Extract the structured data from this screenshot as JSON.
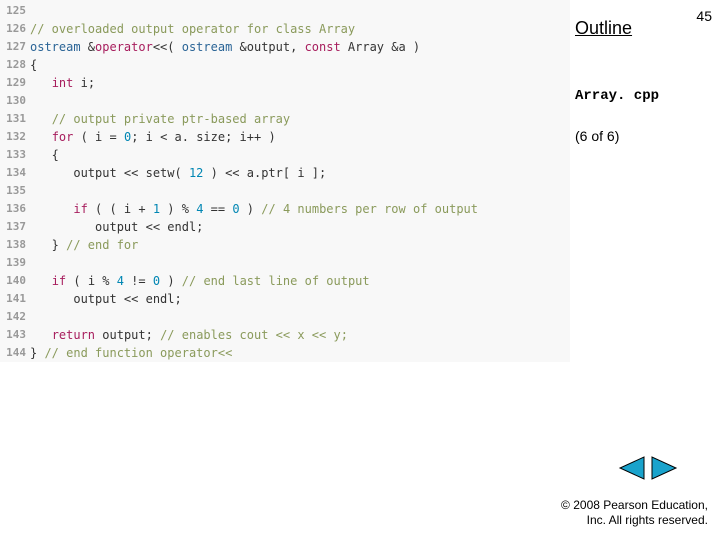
{
  "slide": {
    "outline_label": "Outline",
    "page_number": "45",
    "filename": "Array. cpp",
    "pager": "(6 of 6)",
    "copyright_line1": "© 2008 Pearson Education,",
    "copyright_line2": "Inc.  All rights reserved."
  },
  "code": {
    "lines": [
      {
        "n": "125",
        "tokens": []
      },
      {
        "n": "126",
        "tokens": [
          {
            "c": "c-comment",
            "t": "// overloaded output operator for class Array"
          }
        ]
      },
      {
        "n": "127",
        "tokens": [
          {
            "c": "c-type",
            "t": "ostream "
          },
          {
            "c": "c-plain",
            "t": "&"
          },
          {
            "c": "c-op",
            "t": "operator"
          },
          {
            "c": "c-plain",
            "t": "<<( "
          },
          {
            "c": "c-type",
            "t": "ostream "
          },
          {
            "c": "c-plain",
            "t": "&output, "
          },
          {
            "c": "c-kw",
            "t": "const"
          },
          {
            "c": "c-plain",
            "t": " Array &a )"
          }
        ]
      },
      {
        "n": "128",
        "tokens": [
          {
            "c": "c-plain",
            "t": "{"
          }
        ]
      },
      {
        "n": "129",
        "tokens": [
          {
            "c": "c-plain",
            "t": "   "
          },
          {
            "c": "c-kw",
            "t": "int"
          },
          {
            "c": "c-plain",
            "t": " i;"
          }
        ]
      },
      {
        "n": "130",
        "tokens": []
      },
      {
        "n": "131",
        "tokens": [
          {
            "c": "c-plain",
            "t": "   "
          },
          {
            "c": "c-comment",
            "t": "// output private ptr-based array"
          }
        ]
      },
      {
        "n": "132",
        "tokens": [
          {
            "c": "c-plain",
            "t": "   "
          },
          {
            "c": "c-kw",
            "t": "for"
          },
          {
            "c": "c-plain",
            "t": " ( i = "
          },
          {
            "c": "c-num",
            "t": "0"
          },
          {
            "c": "c-plain",
            "t": "; i < a. size; i++ )"
          }
        ]
      },
      {
        "n": "133",
        "tokens": [
          {
            "c": "c-plain",
            "t": "   {"
          }
        ]
      },
      {
        "n": "134",
        "tokens": [
          {
            "c": "c-plain",
            "t": "      output << setw( "
          },
          {
            "c": "c-num",
            "t": "12"
          },
          {
            "c": "c-plain",
            "t": " ) << a.ptr[ i ];"
          }
        ]
      },
      {
        "n": "135",
        "tokens": []
      },
      {
        "n": "136",
        "tokens": [
          {
            "c": "c-plain",
            "t": "      "
          },
          {
            "c": "c-kw",
            "t": "if"
          },
          {
            "c": "c-plain",
            "t": " ( ( i + "
          },
          {
            "c": "c-num",
            "t": "1"
          },
          {
            "c": "c-plain",
            "t": " ) % "
          },
          {
            "c": "c-num",
            "t": "4"
          },
          {
            "c": "c-plain",
            "t": " == "
          },
          {
            "c": "c-num",
            "t": "0"
          },
          {
            "c": "c-plain",
            "t": " ) "
          },
          {
            "c": "c-comment",
            "t": "// 4 numbers per row of output"
          }
        ]
      },
      {
        "n": "137",
        "tokens": [
          {
            "c": "c-plain",
            "t": "         output << endl;"
          }
        ]
      },
      {
        "n": "138",
        "tokens": [
          {
            "c": "c-plain",
            "t": "   } "
          },
          {
            "c": "c-comment",
            "t": "// end for"
          }
        ]
      },
      {
        "n": "139",
        "tokens": []
      },
      {
        "n": "140",
        "tokens": [
          {
            "c": "c-plain",
            "t": "   "
          },
          {
            "c": "c-kw",
            "t": "if"
          },
          {
            "c": "c-plain",
            "t": " ( i % "
          },
          {
            "c": "c-num",
            "t": "4"
          },
          {
            "c": "c-plain",
            "t": " != "
          },
          {
            "c": "c-num",
            "t": "0"
          },
          {
            "c": "c-plain",
            "t": " ) "
          },
          {
            "c": "c-comment",
            "t": "// end last line of output"
          }
        ]
      },
      {
        "n": "141",
        "tokens": [
          {
            "c": "c-plain",
            "t": "      output << endl;"
          }
        ]
      },
      {
        "n": "142",
        "tokens": []
      },
      {
        "n": "143",
        "tokens": [
          {
            "c": "c-plain",
            "t": "   "
          },
          {
            "c": "c-kw",
            "t": "return"
          },
          {
            "c": "c-plain",
            "t": " output; "
          },
          {
            "c": "c-comment",
            "t": "// enables cout << x << y;"
          }
        ]
      },
      {
        "n": "144",
        "tokens": [
          {
            "c": "c-plain",
            "t": "} "
          },
          {
            "c": "c-comment",
            "t": "// end function operator<<"
          }
        ]
      }
    ]
  }
}
